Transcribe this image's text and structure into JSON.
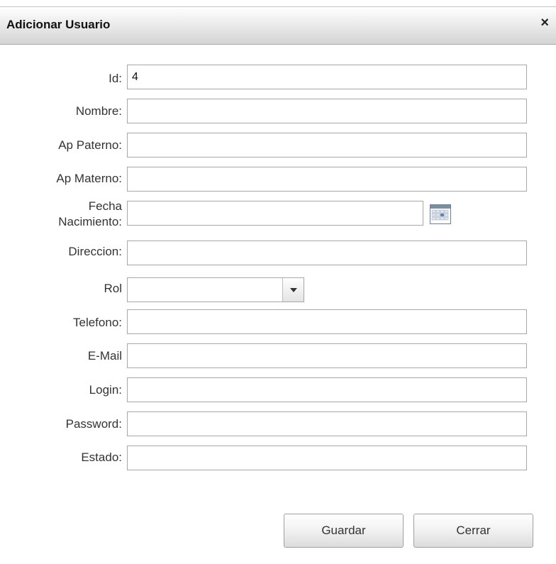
{
  "dialog": {
    "title": "Adicionar Usuario",
    "close_glyph": "×"
  },
  "form": {
    "id": {
      "label": "Id:",
      "value": "4"
    },
    "nombre": {
      "label": "Nombre:",
      "value": ""
    },
    "ap_paterno": {
      "label": "Ap Paterno:",
      "value": ""
    },
    "ap_materno": {
      "label": "Ap Materno:",
      "value": ""
    },
    "fecha_nacimiento": {
      "label_line1": "Fecha",
      "label_line2": "Nacimiento:",
      "value": "",
      "icon": "calendar-icon"
    },
    "direccion": {
      "label": "Direccion:",
      "value": ""
    },
    "rol": {
      "label": "Rol",
      "value": "",
      "icon": "chevron-down-icon"
    },
    "telefono": {
      "label": "Telefono:",
      "value": ""
    },
    "email": {
      "label": "E-Mail",
      "value": ""
    },
    "login": {
      "label": "Login:",
      "value": ""
    },
    "password": {
      "label": "Password:",
      "value": ""
    },
    "estado": {
      "label": "Estado:",
      "value": ""
    }
  },
  "buttons": {
    "save_label": "Guardar",
    "close_label": "Cerrar"
  },
  "colors": {
    "border": "#a8a8a8",
    "titlebar_top": "#ffffff",
    "titlebar_bottom": "#d4d4d4"
  }
}
